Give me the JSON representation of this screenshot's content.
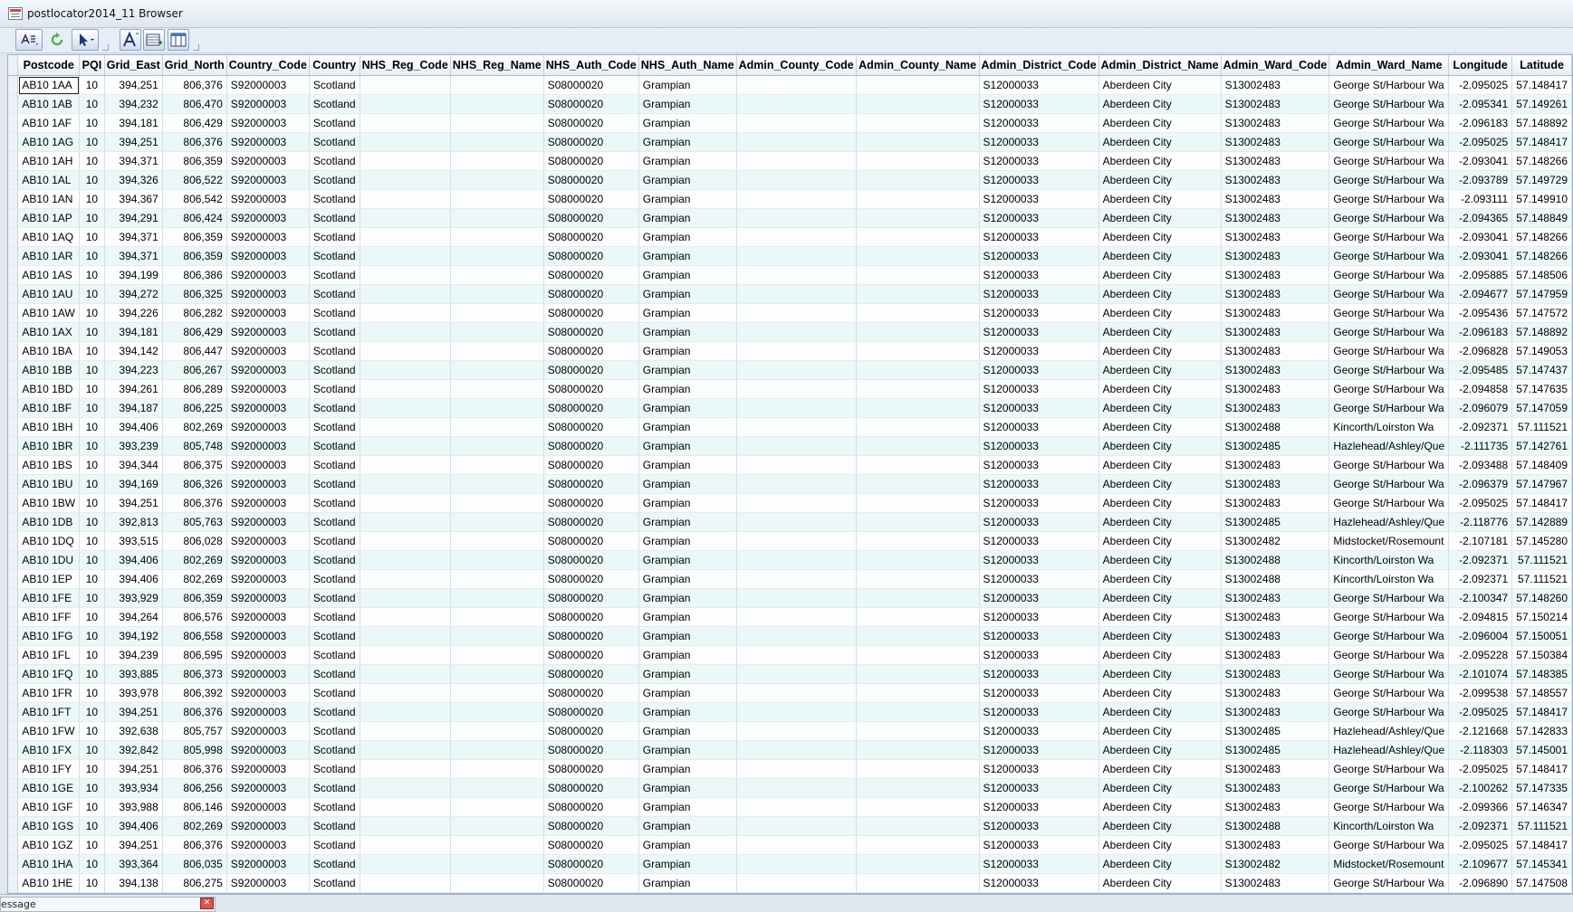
{
  "window": {
    "title": "postlocator2014_11 Browser"
  },
  "toolbar": {
    "icons": [
      "table-format-icon",
      "refresh-icon",
      "select-pointer-icon",
      "font-icon",
      "new-record-icon",
      "columns-icon"
    ]
  },
  "table": {
    "columns": [
      "Postcode",
      "PQI",
      "Grid_East",
      "Grid_North",
      "Country_Code",
      "Country",
      "NHS_Reg_Code",
      "NHS_Reg_Name",
      "NHS_Auth_Code",
      "NHS_Auth_Name",
      "Admin_County_Code",
      "Admin_County_Name",
      "Admin_District_Code",
      "Admin_District_Name",
      "Admin_Ward_Code",
      "Admin_Ward_Name",
      "Longitude",
      "Latitude"
    ],
    "rows": [
      [
        "AB10 1AA",
        "10",
        "394,251",
        "806,376",
        "S92000003",
        "Scotland",
        "",
        "",
        "S08000020",
        "Grampian",
        "",
        "",
        "S12000033",
        "Aberdeen City",
        "S13002483",
        "George St/Harbour Wa",
        "-2.095025",
        "57.148417"
      ],
      [
        "AB10 1AB",
        "10",
        "394,232",
        "806,470",
        "S92000003",
        "Scotland",
        "",
        "",
        "S08000020",
        "Grampian",
        "",
        "",
        "S12000033",
        "Aberdeen City",
        "S13002483",
        "George St/Harbour Wa",
        "-2.095341",
        "57.149261"
      ],
      [
        "AB10 1AF",
        "10",
        "394,181",
        "806,429",
        "S92000003",
        "Scotland",
        "",
        "",
        "S08000020",
        "Grampian",
        "",
        "",
        "S12000033",
        "Aberdeen City",
        "S13002483",
        "George St/Harbour Wa",
        "-2.096183",
        "57.148892"
      ],
      [
        "AB10 1AG",
        "10",
        "394,251",
        "806,376",
        "S92000003",
        "Scotland",
        "",
        "",
        "S08000020",
        "Grampian",
        "",
        "",
        "S12000033",
        "Aberdeen City",
        "S13002483",
        "George St/Harbour Wa",
        "-2.095025",
        "57.148417"
      ],
      [
        "AB10 1AH",
        "10",
        "394,371",
        "806,359",
        "S92000003",
        "Scotland",
        "",
        "",
        "S08000020",
        "Grampian",
        "",
        "",
        "S12000033",
        "Aberdeen City",
        "S13002483",
        "George St/Harbour Wa",
        "-2.093041",
        "57.148266"
      ],
      [
        "AB10 1AL",
        "10",
        "394,326",
        "806,522",
        "S92000003",
        "Scotland",
        "",
        "",
        "S08000020",
        "Grampian",
        "",
        "",
        "S12000033",
        "Aberdeen City",
        "S13002483",
        "George St/Harbour Wa",
        "-2.093789",
        "57.149729"
      ],
      [
        "AB10 1AN",
        "10",
        "394,367",
        "806,542",
        "S92000003",
        "Scotland",
        "",
        "",
        "S08000020",
        "Grampian",
        "",
        "",
        "S12000033",
        "Aberdeen City",
        "S13002483",
        "George St/Harbour Wa",
        "-2.093111",
        "57.149910"
      ],
      [
        "AB10 1AP",
        "10",
        "394,291",
        "806,424",
        "S92000003",
        "Scotland",
        "",
        "",
        "S08000020",
        "Grampian",
        "",
        "",
        "S12000033",
        "Aberdeen City",
        "S13002483",
        "George St/Harbour Wa",
        "-2.094365",
        "57.148849"
      ],
      [
        "AB10 1AQ",
        "10",
        "394,371",
        "806,359",
        "S92000003",
        "Scotland",
        "",
        "",
        "S08000020",
        "Grampian",
        "",
        "",
        "S12000033",
        "Aberdeen City",
        "S13002483",
        "George St/Harbour Wa",
        "-2.093041",
        "57.148266"
      ],
      [
        "AB10 1AR",
        "10",
        "394,371",
        "806,359",
        "S92000003",
        "Scotland",
        "",
        "",
        "S08000020",
        "Grampian",
        "",
        "",
        "S12000033",
        "Aberdeen City",
        "S13002483",
        "George St/Harbour Wa",
        "-2.093041",
        "57.148266"
      ],
      [
        "AB10 1AS",
        "10",
        "394,199",
        "806,386",
        "S92000003",
        "Scotland",
        "",
        "",
        "S08000020",
        "Grampian",
        "",
        "",
        "S12000033",
        "Aberdeen City",
        "S13002483",
        "George St/Harbour Wa",
        "-2.095885",
        "57.148506"
      ],
      [
        "AB10 1AU",
        "10",
        "394,272",
        "806,325",
        "S92000003",
        "Scotland",
        "",
        "",
        "S08000020",
        "Grampian",
        "",
        "",
        "S12000033",
        "Aberdeen City",
        "S13002483",
        "George St/Harbour Wa",
        "-2.094677",
        "57.147959"
      ],
      [
        "AB10 1AW",
        "10",
        "394,226",
        "806,282",
        "S92000003",
        "Scotland",
        "",
        "",
        "S08000020",
        "Grampian",
        "",
        "",
        "S12000033",
        "Aberdeen City",
        "S13002483",
        "George St/Harbour Wa",
        "-2.095436",
        "57.147572"
      ],
      [
        "AB10 1AX",
        "10",
        "394,181",
        "806,429",
        "S92000003",
        "Scotland",
        "",
        "",
        "S08000020",
        "Grampian",
        "",
        "",
        "S12000033",
        "Aberdeen City",
        "S13002483",
        "George St/Harbour Wa",
        "-2.096183",
        "57.148892"
      ],
      [
        "AB10 1BA",
        "10",
        "394,142",
        "806,447",
        "S92000003",
        "Scotland",
        "",
        "",
        "S08000020",
        "Grampian",
        "",
        "",
        "S12000033",
        "Aberdeen City",
        "S13002483",
        "George St/Harbour Wa",
        "-2.096828",
        "57.149053"
      ],
      [
        "AB10 1BB",
        "10",
        "394,223",
        "806,267",
        "S92000003",
        "Scotland",
        "",
        "",
        "S08000020",
        "Grampian",
        "",
        "",
        "S12000033",
        "Aberdeen City",
        "S13002483",
        "George St/Harbour Wa",
        "-2.095485",
        "57.147437"
      ],
      [
        "AB10 1BD",
        "10",
        "394,261",
        "806,289",
        "S92000003",
        "Scotland",
        "",
        "",
        "S08000020",
        "Grampian",
        "",
        "",
        "S12000033",
        "Aberdeen City",
        "S13002483",
        "George St/Harbour Wa",
        "-2.094858",
        "57.147635"
      ],
      [
        "AB10 1BF",
        "10",
        "394,187",
        "806,225",
        "S92000003",
        "Scotland",
        "",
        "",
        "S08000020",
        "Grampian",
        "",
        "",
        "S12000033",
        "Aberdeen City",
        "S13002483",
        "George St/Harbour Wa",
        "-2.096079",
        "57.147059"
      ],
      [
        "AB10 1BH",
        "10",
        "394,406",
        "802,269",
        "S92000003",
        "Scotland",
        "",
        "",
        "S08000020",
        "Grampian",
        "",
        "",
        "S12000033",
        "Aberdeen City",
        "S13002488",
        "Kincorth/Loirston Wa",
        "-2.092371",
        "57.111521"
      ],
      [
        "AB10 1BR",
        "10",
        "393,239",
        "805,748",
        "S92000003",
        "Scotland",
        "",
        "",
        "S08000020",
        "Grampian",
        "",
        "",
        "S12000033",
        "Aberdeen City",
        "S13002485",
        "Hazlehead/Ashley/Que",
        "-2.111735",
        "57.142761"
      ],
      [
        "AB10 1BS",
        "10",
        "394,344",
        "806,375",
        "S92000003",
        "Scotland",
        "",
        "",
        "S08000020",
        "Grampian",
        "",
        "",
        "S12000033",
        "Aberdeen City",
        "S13002483",
        "George St/Harbour Wa",
        "-2.093488",
        "57.148409"
      ],
      [
        "AB10 1BU",
        "10",
        "394,169",
        "806,326",
        "S92000003",
        "Scotland",
        "",
        "",
        "S08000020",
        "Grampian",
        "",
        "",
        "S12000033",
        "Aberdeen City",
        "S13002483",
        "George St/Harbour Wa",
        "-2.096379",
        "57.147967"
      ],
      [
        "AB10 1BW",
        "10",
        "394,251",
        "806,376",
        "S92000003",
        "Scotland",
        "",
        "",
        "S08000020",
        "Grampian",
        "",
        "",
        "S12000033",
        "Aberdeen City",
        "S13002483",
        "George St/Harbour Wa",
        "-2.095025",
        "57.148417"
      ],
      [
        "AB10 1DB",
        "10",
        "392,813",
        "805,763",
        "S92000003",
        "Scotland",
        "",
        "",
        "S08000020",
        "Grampian",
        "",
        "",
        "S12000033",
        "Aberdeen City",
        "S13002485",
        "Hazlehead/Ashley/Que",
        "-2.118776",
        "57.142889"
      ],
      [
        "AB10 1DQ",
        "10",
        "393,515",
        "806,028",
        "S92000003",
        "Scotland",
        "",
        "",
        "S08000020",
        "Grampian",
        "",
        "",
        "S12000033",
        "Aberdeen City",
        "S13002482",
        "Midstocket/Rosemount",
        "-2.107181",
        "57.145280"
      ],
      [
        "AB10 1DU",
        "10",
        "394,406",
        "802,269",
        "S92000003",
        "Scotland",
        "",
        "",
        "S08000020",
        "Grampian",
        "",
        "",
        "S12000033",
        "Aberdeen City",
        "S13002488",
        "Kincorth/Loirston Wa",
        "-2.092371",
        "57.111521"
      ],
      [
        "AB10 1EP",
        "10",
        "394,406",
        "802,269",
        "S92000003",
        "Scotland",
        "",
        "",
        "S08000020",
        "Grampian",
        "",
        "",
        "S12000033",
        "Aberdeen City",
        "S13002488",
        "Kincorth/Loirston Wa",
        "-2.092371",
        "57.111521"
      ],
      [
        "AB10 1FE",
        "10",
        "393,929",
        "806,359",
        "S92000003",
        "Scotland",
        "",
        "",
        "S08000020",
        "Grampian",
        "",
        "",
        "S12000033",
        "Aberdeen City",
        "S13002483",
        "George St/Harbour Wa",
        "-2.100347",
        "57.148260"
      ],
      [
        "AB10 1FF",
        "10",
        "394,264",
        "806,576",
        "S92000003",
        "Scotland",
        "",
        "",
        "S08000020",
        "Grampian",
        "",
        "",
        "S12000033",
        "Aberdeen City",
        "S13002483",
        "George St/Harbour Wa",
        "-2.094815",
        "57.150214"
      ],
      [
        "AB10 1FG",
        "10",
        "394,192",
        "806,558",
        "S92000003",
        "Scotland",
        "",
        "",
        "S08000020",
        "Grampian",
        "",
        "",
        "S12000033",
        "Aberdeen City",
        "S13002483",
        "George St/Harbour Wa",
        "-2.096004",
        "57.150051"
      ],
      [
        "AB10 1FL",
        "10",
        "394,239",
        "806,595",
        "S92000003",
        "Scotland",
        "",
        "",
        "S08000020",
        "Grampian",
        "",
        "",
        "S12000033",
        "Aberdeen City",
        "S13002483",
        "George St/Harbour Wa",
        "-2.095228",
        "57.150384"
      ],
      [
        "AB10 1FQ",
        "10",
        "393,885",
        "806,373",
        "S92000003",
        "Scotland",
        "",
        "",
        "S08000020",
        "Grampian",
        "",
        "",
        "S12000033",
        "Aberdeen City",
        "S13002483",
        "George St/Harbour Wa",
        "-2.101074",
        "57.148385"
      ],
      [
        "AB10 1FR",
        "10",
        "393,978",
        "806,392",
        "S92000003",
        "Scotland",
        "",
        "",
        "S08000020",
        "Grampian",
        "",
        "",
        "S12000033",
        "Aberdeen City",
        "S13002483",
        "George St/Harbour Wa",
        "-2.099538",
        "57.148557"
      ],
      [
        "AB10 1FT",
        "10",
        "394,251",
        "806,376",
        "S92000003",
        "Scotland",
        "",
        "",
        "S08000020",
        "Grampian",
        "",
        "",
        "S12000033",
        "Aberdeen City",
        "S13002483",
        "George St/Harbour Wa",
        "-2.095025",
        "57.148417"
      ],
      [
        "AB10 1FW",
        "10",
        "392,638",
        "805,757",
        "S92000003",
        "Scotland",
        "",
        "",
        "S08000020",
        "Grampian",
        "",
        "",
        "S12000033",
        "Aberdeen City",
        "S13002485",
        "Hazlehead/Ashley/Que",
        "-2.121668",
        "57.142833"
      ],
      [
        "AB10 1FX",
        "10",
        "392,842",
        "805,998",
        "S92000003",
        "Scotland",
        "",
        "",
        "S08000020",
        "Grampian",
        "",
        "",
        "S12000033",
        "Aberdeen City",
        "S13002485",
        "Hazlehead/Ashley/Que",
        "-2.118303",
        "57.145001"
      ],
      [
        "AB10 1FY",
        "10",
        "394,251",
        "806,376",
        "S92000003",
        "Scotland",
        "",
        "",
        "S08000020",
        "Grampian",
        "",
        "",
        "S12000033",
        "Aberdeen City",
        "S13002483",
        "George St/Harbour Wa",
        "-2.095025",
        "57.148417"
      ],
      [
        "AB10 1GE",
        "10",
        "393,934",
        "806,256",
        "S92000003",
        "Scotland",
        "",
        "",
        "S08000020",
        "Grampian",
        "",
        "",
        "S12000033",
        "Aberdeen City",
        "S13002483",
        "George St/Harbour Wa",
        "-2.100262",
        "57.147335"
      ],
      [
        "AB10 1GF",
        "10",
        "393,988",
        "806,146",
        "S92000003",
        "Scotland",
        "",
        "",
        "S08000020",
        "Grampian",
        "",
        "",
        "S12000033",
        "Aberdeen City",
        "S13002483",
        "George St/Harbour Wa",
        "-2.099366",
        "57.146347"
      ],
      [
        "AB10 1GS",
        "10",
        "394,406",
        "802,269",
        "S92000003",
        "Scotland",
        "",
        "",
        "S08000020",
        "Grampian",
        "",
        "",
        "S12000033",
        "Aberdeen City",
        "S13002488",
        "Kincorth/Loirston Wa",
        "-2.092371",
        "57.111521"
      ],
      [
        "AB10 1GZ",
        "10",
        "394,251",
        "806,376",
        "S92000003",
        "Scotland",
        "",
        "",
        "S08000020",
        "Grampian",
        "",
        "",
        "S12000033",
        "Aberdeen City",
        "S13002483",
        "George St/Harbour Wa",
        "-2.095025",
        "57.148417"
      ],
      [
        "AB10 1HA",
        "10",
        "393,364",
        "806,035",
        "S92000003",
        "Scotland",
        "",
        "",
        "S08000020",
        "Grampian",
        "",
        "",
        "S12000033",
        "Aberdeen City",
        "S13002482",
        "Midstocket/Rosemount",
        "-2.109677",
        "57.145341"
      ],
      [
        "AB10 1HE",
        "10",
        "394,138",
        "806,275",
        "S92000003",
        "Scotland",
        "",
        "",
        "S08000020",
        "Grampian",
        "",
        "",
        "S12000033",
        "Aberdeen City",
        "S13002483",
        "George St/Harbour Wa",
        "-2.096890",
        "57.147508"
      ]
    ]
  },
  "status": {
    "message_label": "essage"
  }
}
